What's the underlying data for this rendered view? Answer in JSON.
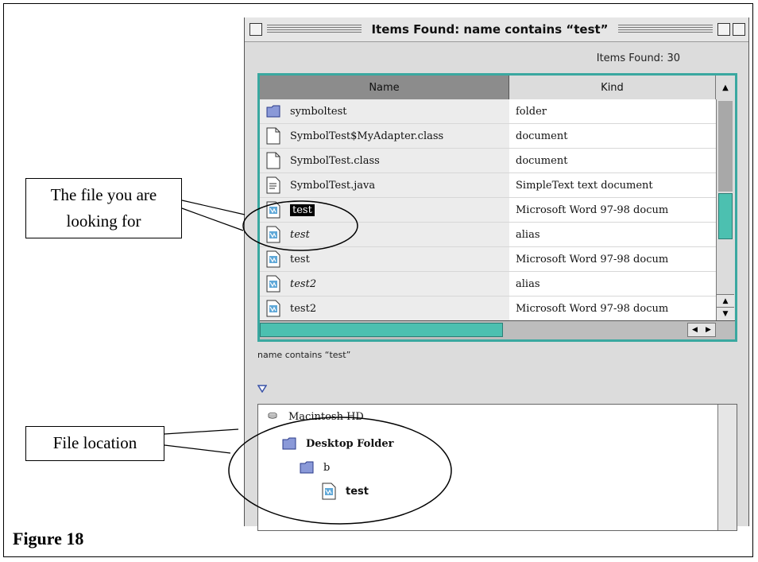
{
  "window": {
    "title": "Items Found: name contains “test”",
    "items_found": "Items Found: 30"
  },
  "list": {
    "columns": [
      "Name",
      "Kind"
    ],
    "rows": [
      {
        "name": "symboltest",
        "kind": "folder",
        "icon": "folder-icon"
      },
      {
        "name": "SymbolTest$MyAdapter.class",
        "kind": "document",
        "icon": "document-icon"
      },
      {
        "name": "SymbolTest.class",
        "kind": "document",
        "icon": "document-icon"
      },
      {
        "name": "SymbolTest.java",
        "kind": "SimpleText text document",
        "icon": "text-document-icon"
      },
      {
        "name": "test",
        "kind": "Microsoft Word 97-98 docum",
        "icon": "word-document-icon",
        "selected": true
      },
      {
        "name": "test",
        "kind": "alias",
        "icon": "word-document-icon",
        "alias": true
      },
      {
        "name": "test",
        "kind": "Microsoft Word 97-98 docum",
        "icon": "word-document-icon"
      },
      {
        "name": "test2",
        "kind": "alias",
        "icon": "word-document-icon",
        "alias": true
      },
      {
        "name": "test2",
        "kind": "Microsoft Word 97-98 docum",
        "icon": "word-document-icon"
      }
    ]
  },
  "criteria": "name contains “test”",
  "location": {
    "path": [
      {
        "name": "Macintosh HD",
        "icon": "hard-disk-icon"
      },
      {
        "name": "Desktop Folder",
        "icon": "folder-icon"
      },
      {
        "name": "b",
        "icon": "folder-icon"
      },
      {
        "name": "test",
        "icon": "word-document-icon"
      }
    ]
  },
  "callouts": {
    "file_you_are_looking_for_line1": "The file you are",
    "file_you_are_looking_for_line2": "looking for",
    "file_location": "File location"
  },
  "caption": "Figure 18",
  "colors": {
    "accent": "#3aa8a0",
    "thumb": "#4cc0b0",
    "window_bg": "#dcdcdc"
  }
}
